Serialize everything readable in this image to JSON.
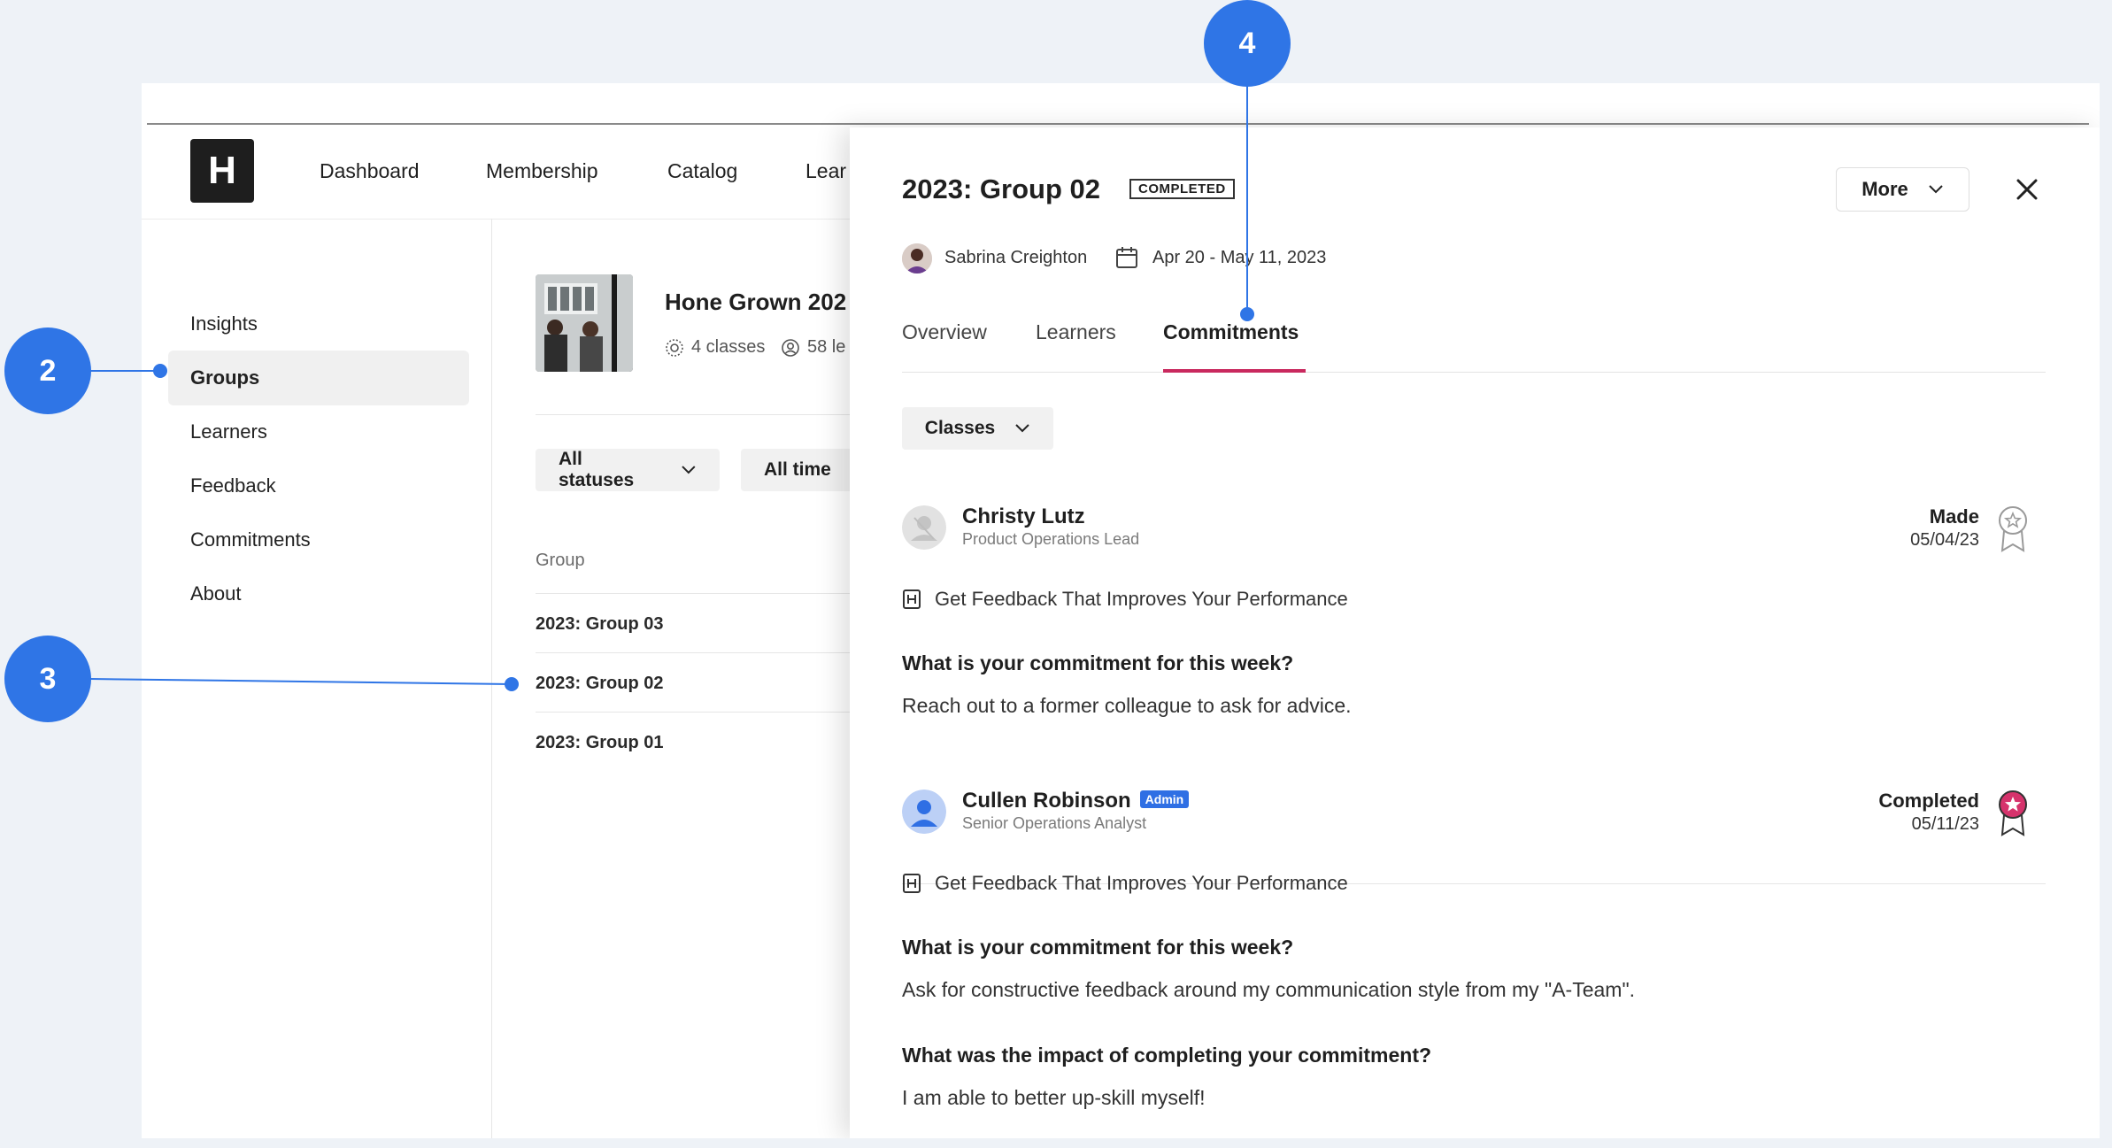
{
  "nav": {
    "logo": "H",
    "items": [
      "Dashboard",
      "Membership",
      "Catalog",
      "Lear"
    ]
  },
  "sidebar": {
    "items": [
      "Insights",
      "Groups",
      "Learners",
      "Feedback",
      "Commitments",
      "About"
    ]
  },
  "group_panel": {
    "title": "Hone Grown 202",
    "classes": "4 classes",
    "learners": "58 le",
    "filters": {
      "status": "All statuses",
      "time": "All time"
    },
    "column": "Group",
    "rows": [
      "2023: Group 03",
      "2023: Group 02",
      "2023: Group 01"
    ]
  },
  "drawer": {
    "title": "2023: Group 02",
    "badge": "COMPLETED",
    "more": "More",
    "owner": "Sabrina Creighton",
    "dates": "Apr 20 - May 11, 2023",
    "tabs": [
      "Overview",
      "Learners",
      "Commitments"
    ],
    "filter": "Classes",
    "commitments": [
      {
        "name": "Christy Lutz",
        "role": "Product Operations Lead",
        "status": "Made",
        "date": "05/04/23",
        "class": "Get Feedback That Improves Your Performance",
        "question": "What is your commitment for this week?",
        "answer": "Reach out to a former colleague to ask for advice."
      },
      {
        "name": "Cullen Robinson",
        "admin": "Admin",
        "role": "Senior Operations Analyst",
        "status": "Completed",
        "date": "05/11/23",
        "class": "Get Feedback That Improves Your Performance",
        "question": "What is your commitment for this week?",
        "answer": "Ask for constructive feedback around my communication style from my \"A-Team\".",
        "question2": "What was the impact of completing your commitment?",
        "answer2": "I am able to better up-skill myself!"
      }
    ]
  },
  "callouts": [
    "2",
    "3",
    "4"
  ],
  "colors": {
    "accent": "#2f75e6",
    "tab_underline": "#c9295e",
    "admin_badge": "#2f6fe4",
    "award_active": "#d6336c"
  }
}
